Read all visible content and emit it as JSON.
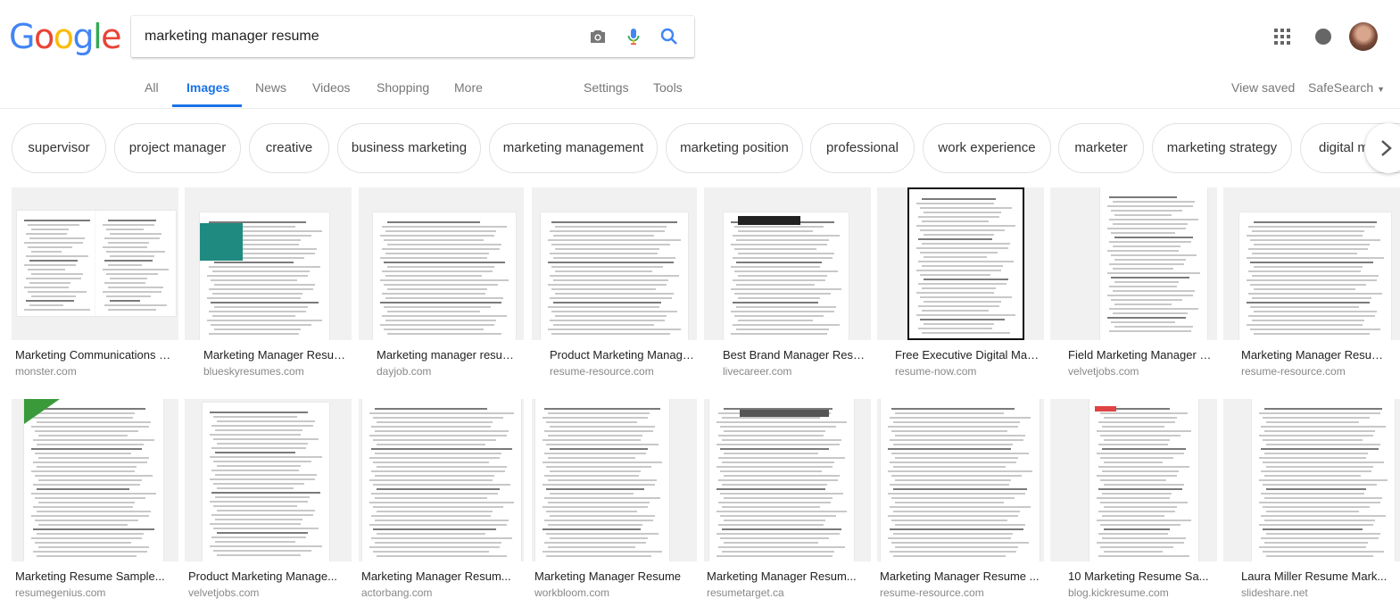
{
  "logo": {
    "letters": [
      "G",
      "o",
      "o",
      "g",
      "l",
      "e"
    ],
    "colors": [
      "#4285f4",
      "#ea4335",
      "#fbbc05",
      "#4285f4",
      "#34a853",
      "#ea4335"
    ]
  },
  "search": {
    "query": "marketing manager resume"
  },
  "tabs": [
    "All",
    "Images",
    "News",
    "Videos",
    "Shopping",
    "More"
  ],
  "active_tab": "Images",
  "tools": {
    "settings": "Settings",
    "tools": "Tools"
  },
  "right": {
    "view_saved": "View saved",
    "safesearch": "SafeSearch"
  },
  "chips": [
    "supervisor",
    "project manager",
    "creative",
    "business marketing",
    "marketing management",
    "marketing position",
    "professional",
    "work experience",
    "marketer",
    "marketing strategy",
    "digital marketing"
  ],
  "results": [
    {
      "title": "Marketing Communications M...",
      "source": "monster.com"
    },
    {
      "title": "Marketing Manager Resum...",
      "source": "blueskyresumes.com"
    },
    {
      "title": "Marketing manager resum...",
      "source": "dayjob.com"
    },
    {
      "title": "Product Marketing Manage...",
      "source": "resume-resource.com"
    },
    {
      "title": "Best Brand Manager Resu...",
      "source": "livecareer.com"
    },
    {
      "title": "Free Executive Digital Mar...",
      "source": "resume-now.com"
    },
    {
      "title": "Field Marketing Manager R...",
      "source": "velvetjobs.com"
    },
    {
      "title": "Marketing Manager Resum...",
      "source": "resume-resource.com"
    },
    {
      "title": "Marketing Resume Sample...",
      "source": "resumegenius.com"
    },
    {
      "title": "Product Marketing Manage...",
      "source": "velvetjobs.com"
    },
    {
      "title": "Marketing Manager Resum...",
      "source": "actorbang.com"
    },
    {
      "title": "Marketing Manager Resume",
      "source": "workbloom.com"
    },
    {
      "title": "Marketing Manager Resum...",
      "source": "resumetarget.ca"
    },
    {
      "title": "Marketing Manager Resume ...",
      "source": "resume-resource.com"
    },
    {
      "title": "10 Marketing Resume Sa...",
      "source": "blog.kickresume.com"
    },
    {
      "title": "Laura Miller Resume Mark...",
      "source": "slideshare.net"
    }
  ]
}
